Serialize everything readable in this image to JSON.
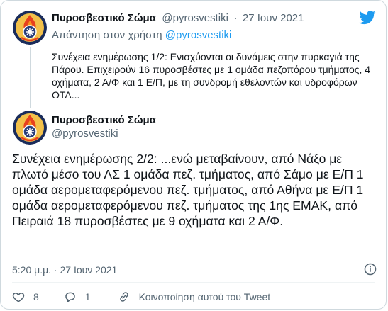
{
  "parent": {
    "name": "Πυροσβεστικό Σώμα",
    "handle": "@pyrosvestiki",
    "date": "27 Ιουν 2021",
    "reply_prefix": "Απάντηση στον χρήστη",
    "reply_handle": "@pyrosvestiki",
    "text": "Συνέχεια ενημέρωσης 1/2: Ενισχύονται οι δυνάμεις στην πυρκαγιά της Πάρου. Επιχειρούν 16 πυροσβέστες με 1 ομάδα πεζοπόρου τμήματος, 4 οχήματα, 2 Α/Φ και 1 Ε/Π, με τη συνδρομή εθελοντών και υδροφόρων ΟΤΑ..."
  },
  "tweet": {
    "name": "Πυροσβεστικό Σώμα",
    "handle": "@pyrosvestiki",
    "text": "Συνέχεια ενημέρωσης 2/2: ...ενώ μεταβαίνουν, από Νάξο με πλωτό μέσο του ΛΣ 1 ομάδα πεζ. τμήματος, από Σάμο με Ε/Π 1 ομάδα αερομεταφερόμενου πεζ. τμήματος, από Αθήνα με Ε/Π 1 ομάδα αερομεταφερόμενου πεζ. τμήματος της 1ης ΕΜΑΚ, από Πειραιά 18 πυροσβέστες με 9 οχήματα και 2 Α/Φ.",
    "timestamp": "5:20 μ.μ. · 27 Ιουν 2021"
  },
  "actions": {
    "likes": "8",
    "replies": "1",
    "share_label": "Κοινοποίηση αυτού του Tweet"
  },
  "icons": {
    "brand": "twitter-bird-icon",
    "info": "info-icon",
    "like": "heart-icon",
    "reply": "reply-icon",
    "share": "share-icon"
  },
  "colors": {
    "twitter_blue": "#1d9bf0",
    "muted_text": "#536471",
    "border": "#cfd9de",
    "text": "#0f1419"
  }
}
